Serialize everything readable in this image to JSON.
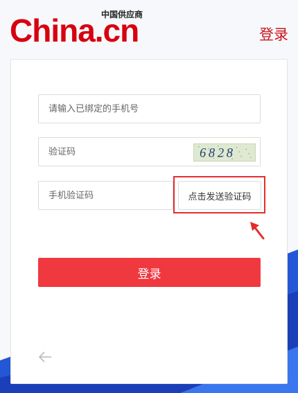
{
  "header": {
    "logo_main": "China.cn",
    "logo_sub": "中国供应商",
    "login_link": "登录"
  },
  "form": {
    "phone_placeholder": "请输入已绑定的手机号",
    "captcha_placeholder": "验证码",
    "captcha_code": "6828",
    "sms_placeholder": "手机验证码",
    "send_sms_label": "点击发送验证码",
    "submit_label": "登录"
  },
  "icons": {
    "back": "left-arrow-icon",
    "annotation": "red-pointer-arrow-icon"
  },
  "colors": {
    "brand_red": "#d7000f",
    "button_red": "#f0383f",
    "highlight_red": "#e32d2d",
    "bg_blue": "#1f4fd1"
  }
}
